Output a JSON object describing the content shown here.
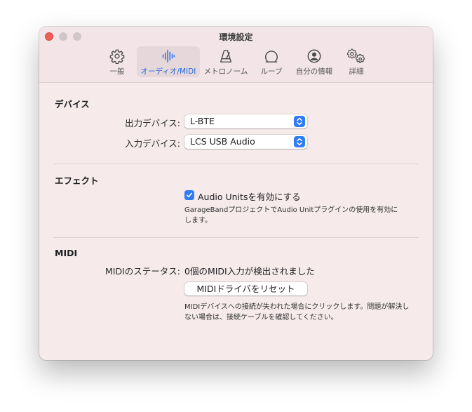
{
  "window": {
    "title": "環境設定"
  },
  "toolbar": {
    "tabs": [
      {
        "label": "一般",
        "icon": "gear-icon"
      },
      {
        "label": "オーディオ/MIDI",
        "icon": "audio-waveform-icon",
        "active": true
      },
      {
        "label": "メトロノーム",
        "icon": "metronome-icon"
      },
      {
        "label": "ループ",
        "icon": "loop-icon"
      },
      {
        "label": "自分の情報",
        "icon": "person-icon"
      },
      {
        "label": "詳細",
        "icon": "gears-icon"
      }
    ]
  },
  "devices": {
    "title": "デバイス",
    "output_label": "出力デバイス:",
    "output_value": "L-BTE",
    "input_label": "入力デバイス:",
    "input_value": "LCS USB Audio"
  },
  "effects": {
    "title": "エフェクト",
    "audio_units_label": "Audio Unitsを有効にする",
    "audio_units_checked": true,
    "note_line1": "GarageBandプロジェクトでAudio Unitプラグインの使用を有効に",
    "note_line2": "します。"
  },
  "midi": {
    "title": "MIDI",
    "status_label": "MIDIのステータス:",
    "status_value": "0個のMIDI入力が検出されました",
    "reset_button": "MIDIドライバをリセット",
    "note_line1": "MIDIデバイスへの接続が失われた場合にクリックします。問題が解決し",
    "note_line2": "ない場合は、接続ケーブルを確認してください。"
  },
  "colors": {
    "accent": "#2f7cf6",
    "window_bg": "#f6eaeb",
    "active_tab_label": "#2668d6"
  }
}
